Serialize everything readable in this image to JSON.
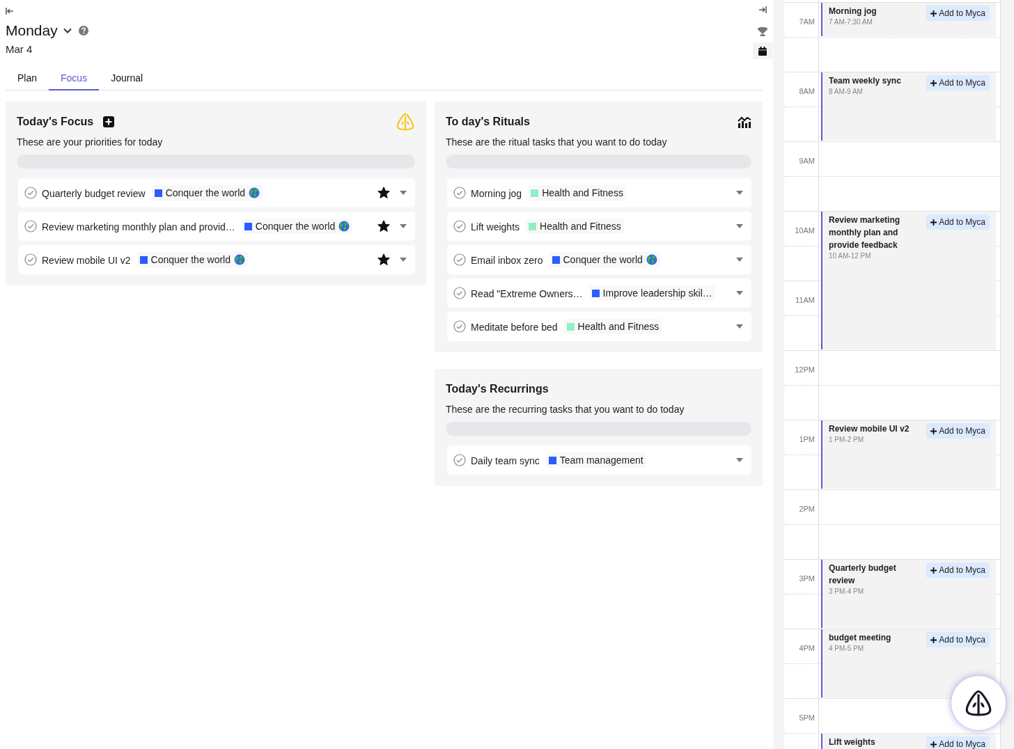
{
  "header": {
    "title": "Monday",
    "date": "Mar 4"
  },
  "tabs": [
    {
      "label": "Plan",
      "selected": false
    },
    {
      "label": "Focus",
      "selected": true
    },
    {
      "label": "Journal",
      "selected": false
    }
  ],
  "cards": [
    {
      "kind": "focus",
      "title": "Today's Focus",
      "subtitle": "These are your priorities for today",
      "progress": {
        "level": 0
      },
      "tasks": [
        {
          "title": "Quarterly budget review",
          "tag": {
            "label": "Conquer the world",
            "color": "#2b5cff",
            "globe": true
          },
          "starred": true
        },
        {
          "title": "Review marketing monthly plan and provid…",
          "tag": {
            "label": "Conquer the world",
            "color": "#2b5cff",
            "globe": true
          },
          "starred": true
        },
        {
          "title": "Review mobile UI v2",
          "tag": {
            "label": "Conquer the world",
            "color": "#2b5cff",
            "globe": true
          },
          "starred": true
        }
      ]
    },
    {
      "kind": "rituals",
      "title": "To day's Rituals",
      "subtitle": "These are the ritual tasks that you want to do today",
      "progress": {
        "level": 0
      },
      "tasks": [
        {
          "title": "Morning jog",
          "tag": {
            "label": "Health and Fitness",
            "color": "#8ff0c6"
          }
        },
        {
          "title": "Lift weights",
          "tag": {
            "label": "Health and Fitness",
            "color": "#8ff0c6"
          }
        },
        {
          "title": "Email inbox zero",
          "tag": {
            "label": "Conquer the world",
            "color": "#2b5cff",
            "globe": true
          }
        },
        {
          "title": "Read \"Extreme Owners…",
          "tag": {
            "label": "Improve leadership skil…",
            "color": "#2b5cff"
          }
        },
        {
          "title": "Meditate before bed",
          "tag": {
            "label": "Health and Fitness",
            "color": "#8ff0c6"
          }
        }
      ]
    },
    {
      "kind": "recurrings",
      "title": "Today's Recurrings",
      "subtitle": "These are the recurring tasks that you want to do today",
      "progress": {
        "level": 0
      },
      "tasks": [
        {
          "title": "Daily team sync",
          "tag": {
            "label": "Team management",
            "color": "#2b5cff"
          }
        }
      ]
    }
  ],
  "calendar": {
    "hours": [
      {
        "label": "7AM",
        "events": [
          {
            "kind": "short",
            "title": "Morning jog",
            "time": "7 AM-7:30 AM",
            "action": "Add to Myca"
          }
        ]
      },
      {
        "label": "8AM",
        "events": [
          {
            "kind": "hour",
            "title": "Team weekly sync",
            "time": "8 AM-9 AM",
            "action": "Add to Myca"
          }
        ]
      },
      {
        "label": "9AM"
      },
      {
        "label": "10AM",
        "events": [
          {
            "kind": "long",
            "title": "Review marketing monthly plan and provide feedback",
            "time": "10 AM-12 PM",
            "action": "Add to Myca"
          }
        ]
      },
      {
        "label": "11AM"
      },
      {
        "label": "12PM"
      },
      {
        "label": "1PM",
        "events": [
          {
            "kind": "hour",
            "title": "Review mobile UI v2",
            "time": "1 PM-2 PM",
            "action": "Add to Myca"
          }
        ]
      },
      {
        "label": "2PM"
      },
      {
        "label": "3PM",
        "events": [
          {
            "kind": "hour",
            "title": "Quarterly budget review",
            "time": "3 PM-4 PM",
            "action": "Add to Myca"
          }
        ]
      },
      {
        "label": "4PM",
        "events": [
          {
            "kind": "hour",
            "title": "budget meeting",
            "time": "4 PM-5 PM",
            "action": "Add to Myca"
          }
        ]
      },
      {
        "label": "5PM",
        "events": [
          {
            "kind": "short",
            "title": "Lift weights",
            "half_past": true,
            "action": "Add to Myca"
          }
        ]
      }
    ]
  }
}
